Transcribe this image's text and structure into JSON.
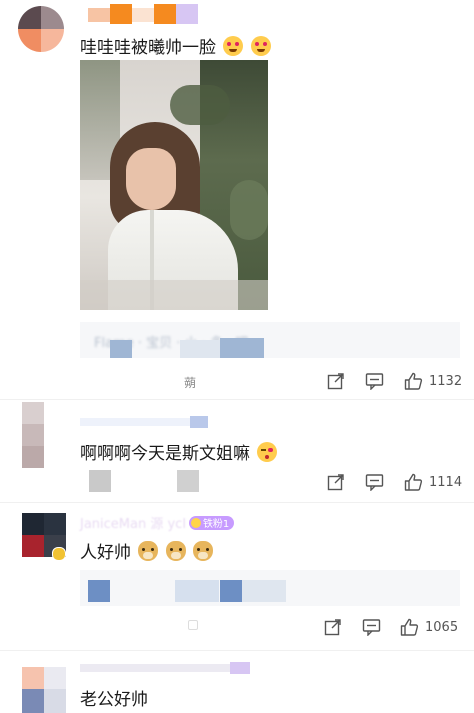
{
  "comments": [
    {
      "text": "哇哇哇被曦帅一脸",
      "emojis": [
        "heart-eyes-cat-emoji",
        "heart-eyes-cat-emoji"
      ],
      "likes": "1132",
      "reply_preview_char": "蒴"
    },
    {
      "text": "啊啊啊今天是斯文姐嘛",
      "emojis": [
        "kiss-face-emoji"
      ],
      "likes": "1114"
    },
    {
      "username": "JaniceMan 源 ycl",
      "badge": "铁粉1",
      "text": "人好帅",
      "emojis": [
        "doge-emoji",
        "doge-emoji",
        "doge-emoji"
      ],
      "likes": "1065"
    },
    {
      "text": "老公好帅"
    }
  ],
  "reply_preview_text": "Flame · 宝贝 · 小 · 多 · 吧",
  "colors": {
    "accent_orange": "#f58a1f",
    "badge_purple": "#c79bff",
    "verified_gold": "#f1c232"
  },
  "icons": [
    "share-icon",
    "comment-icon",
    "thumbs-up-icon",
    "verified-badge-icon"
  ]
}
